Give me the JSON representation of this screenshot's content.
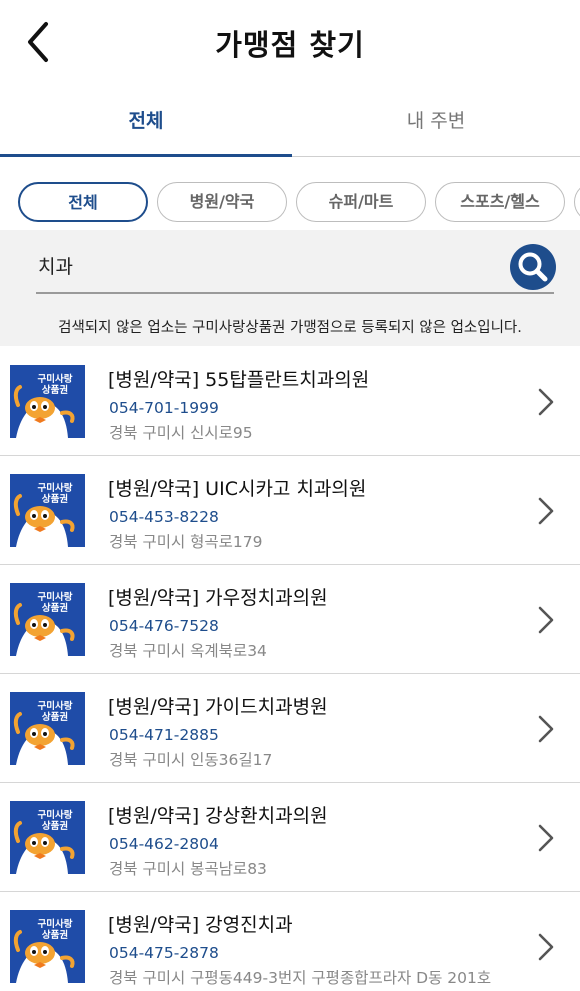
{
  "header": {
    "title": "가맹점 찾기"
  },
  "tabs": [
    {
      "label": "전체"
    },
    {
      "label": "내 주변"
    }
  ],
  "chips": [
    {
      "label": "전체"
    },
    {
      "label": "병원/약국"
    },
    {
      "label": "슈퍼/마트"
    },
    {
      "label": "스포츠/헬스"
    }
  ],
  "search": {
    "value": "치과",
    "notice": "검색되지 않은 업소는 구미사랑상품권 가맹점으로 등록되지 않은 업소입니다."
  },
  "logo_text": "구미사랑\n상품권",
  "colors": {
    "accent": "#1e4d8c",
    "logo_bg": "#1f4ca8"
  },
  "items": [
    {
      "name": "[병원/약국] 55탑플란트치과의원",
      "phone": "054-701-1999",
      "address": "경북 구미시 신시로95"
    },
    {
      "name": "[병원/약국] UIC시카고 치과의원",
      "phone": "054-453-8228",
      "address": "경북 구미시 형곡로179"
    },
    {
      "name": "[병원/약국] 가우정치과의원",
      "phone": "054-476-7528",
      "address": "경북 구미시 옥계북로34"
    },
    {
      "name": "[병원/약국] 가이드치과병원",
      "phone": "054-471-2885",
      "address": "경북 구미시 인동36길17"
    },
    {
      "name": "[병원/약국] 강상환치과의원",
      "phone": "054-462-2804",
      "address": "경북 구미시 봉곡남로83"
    },
    {
      "name": "[병원/약국] 강영진치과",
      "phone": "054-475-2878",
      "address": "경북 구미시 구평동449-3번지 구평종합프라자 D동 201호"
    }
  ]
}
